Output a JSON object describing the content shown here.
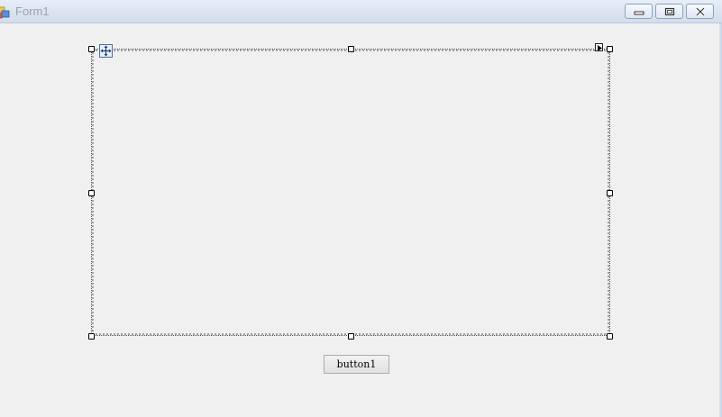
{
  "window": {
    "title": "Form1",
    "icon": "form-icon",
    "controls": {
      "minimize": "minimize-icon",
      "maximize": "maximize-icon",
      "close": "close-icon"
    }
  },
  "designer": {
    "selected_control": {
      "type": "panel",
      "move_glyph": "move-icon",
      "smart_tag": "smart-tag-arrow-icon"
    }
  },
  "form": {
    "button1_label": "button1"
  },
  "colors": {
    "form_background": "#f0f0f0",
    "titlebar": "#dae4f0",
    "title_text": "#9aa4b0"
  }
}
